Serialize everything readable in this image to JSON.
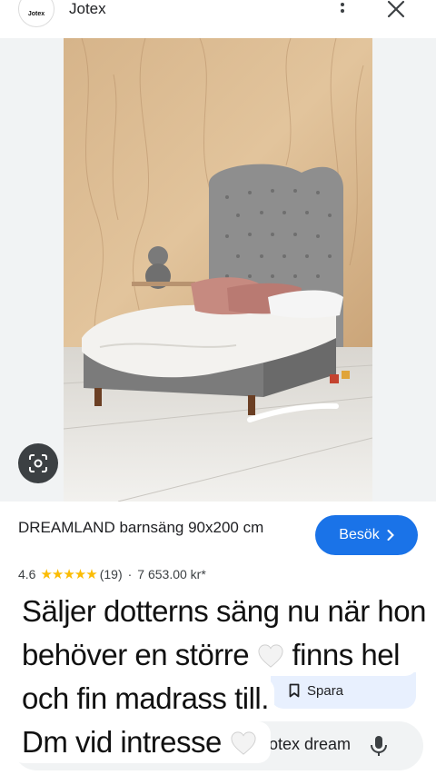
{
  "header": {
    "logo_text": "Jotex",
    "site_name": "Jotex",
    "more_icon": "more-vert-icon",
    "close_icon": "close-icon"
  },
  "image": {
    "lens_icon": "google-lens-icon"
  },
  "product": {
    "title": "DREAMLAND barnsäng 90x200 cm",
    "visit_label": "Besök",
    "rating": "4.6",
    "stars": "★★★★★",
    "review_count": "(19)",
    "price": "7 653.00 kr*"
  },
  "overlay": {
    "line1": "Säljer dotterns säng nu när hon",
    "line2a": "behöver en större",
    "line2b": "finns hel",
    "line3": "och fin madrass till.",
    "line4": "Dm vid intresse"
  },
  "actions": {
    "save_label": "Spara"
  },
  "search": {
    "query_visible": "otex dream"
  },
  "colors": {
    "accent_blue": "#1a73e8",
    "star_yellow": "#fbbc04",
    "chip_bg": "#e8f0fe"
  }
}
